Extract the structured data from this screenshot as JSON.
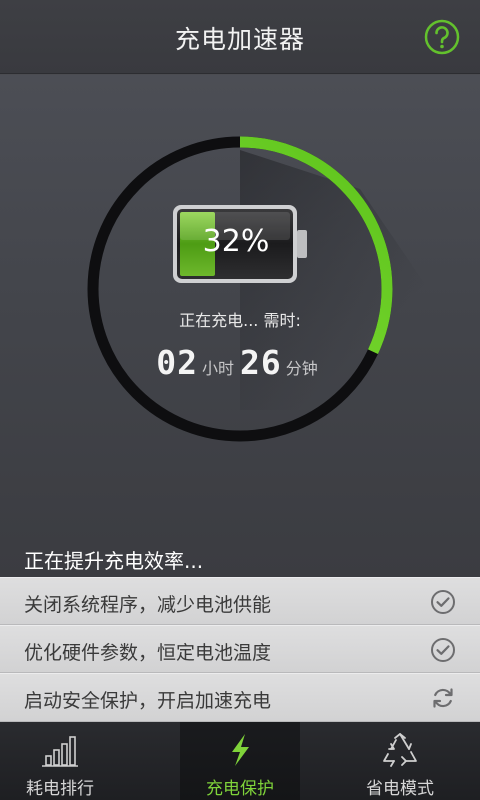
{
  "header": {
    "title": "充电加速器",
    "help_icon": "help-circle-icon"
  },
  "battery": {
    "percent_text": "32%",
    "level": 0.32,
    "charge_progress": 0.32
  },
  "charging": {
    "label": "正在充电... 需时:",
    "hours": "02",
    "hours_unit": "小时",
    "minutes": "26",
    "minutes_unit": "分钟"
  },
  "status_line": "正在提升充电效率...",
  "tasks": [
    {
      "label": "关闭系统程序，减少电池供能",
      "state_icon": "check-circle-icon"
    },
    {
      "label": "优化硬件参数，恒定电池温度",
      "state_icon": "check-circle-icon"
    },
    {
      "label": "启动安全保护，开启加速充电",
      "state_icon": "refresh-icon"
    }
  ],
  "tabs": [
    {
      "label": "耗电排行",
      "icon": "bar-chart-icon",
      "active": false
    },
    {
      "label": "充电保护",
      "icon": "lightning-icon",
      "active": true
    },
    {
      "label": "省电模式",
      "icon": "recycle-icon",
      "active": false
    }
  ],
  "colors": {
    "accent": "#7fd33a",
    "background": "#3c3d42",
    "list": "#d8d8d9"
  }
}
